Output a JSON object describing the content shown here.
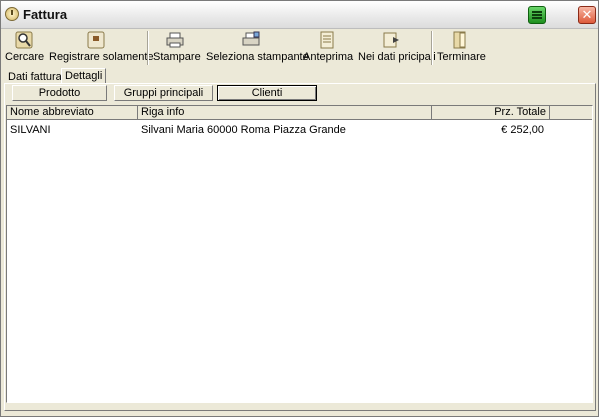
{
  "window": {
    "title": "Fattura"
  },
  "toolbar": {
    "cercare": "Cercare",
    "registrare": "Registrare solamente",
    "stampare": "Stampare",
    "seleziona": "Seleziona stampante",
    "anteprima": "Anteprima",
    "nei_dati": "Nei dati pricipali",
    "terminare": "Terminare"
  },
  "tabs": {
    "dati_fattura": "Dati fattura",
    "dettagli": "Dettagli"
  },
  "subtabs": {
    "prodotto": "Prodotto",
    "gruppi": "Gruppi principali",
    "clienti": "Clienti"
  },
  "table": {
    "columns": [
      "Nome abbreviato",
      "Riga info",
      "Prz. Totale"
    ],
    "rows": [
      {
        "nome": "SILVANI",
        "info": "Silvani Maria 60000 Roma Piazza Grande",
        "totale": "€ 252,00"
      }
    ]
  }
}
